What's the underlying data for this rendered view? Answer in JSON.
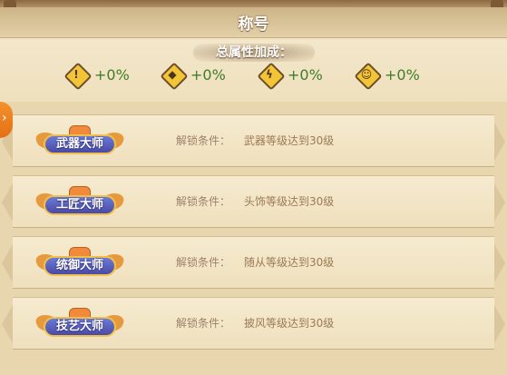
{
  "header": {
    "title": "称号"
  },
  "stats": {
    "title": "总属性加成：",
    "items": [
      {
        "icon": "attack-icon",
        "value": "+0%"
      },
      {
        "icon": "defense-icon",
        "value": "+0%"
      },
      {
        "icon": "lightning-icon",
        "value": "+0%"
      },
      {
        "icon": "pet-face-icon",
        "value": "+0%"
      }
    ]
  },
  "titles": [
    {
      "badge": "武器大师",
      "condition_label": "解锁条件：",
      "condition": "武器等级达到30级"
    },
    {
      "badge": "工匠大师",
      "condition_label": "解锁条件：",
      "condition": "头饰等级达到30级"
    },
    {
      "badge": "统御大师",
      "condition_label": "解锁条件：",
      "condition": "随从等级达到30级"
    },
    {
      "badge": "技艺大师",
      "condition_label": "解锁条件：",
      "condition": "披风等级达到30级"
    }
  ],
  "side_tab": {
    "icon": "chevron-right-icon"
  },
  "colors": {
    "stat_value": "#3f7d2a",
    "condition_text": "#9b7a55",
    "accent_orange": "#e56f16"
  }
}
